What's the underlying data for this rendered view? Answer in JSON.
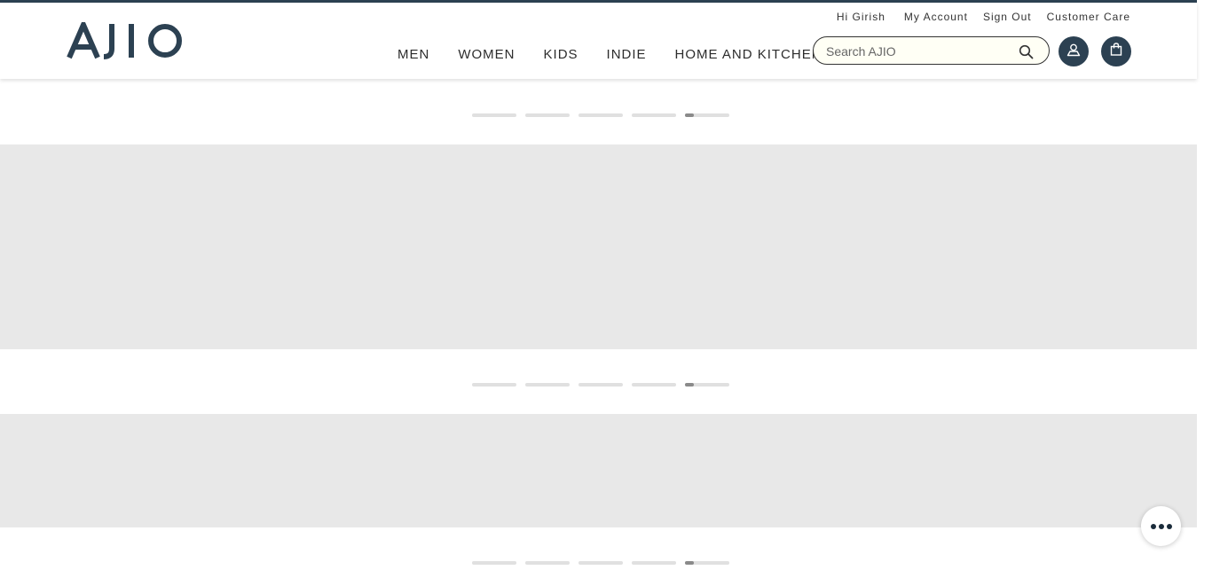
{
  "brand": {
    "logo_text": "AJIO",
    "color": "#2c4152"
  },
  "top_links": {
    "greeting": "Hi Girish",
    "my_account": "My Account",
    "sign_out": "Sign Out",
    "customer_care": "Customer Care"
  },
  "nav": {
    "men": "MEN",
    "women": "WOMEN",
    "kids": "KIDS",
    "indie": "INDIE",
    "home_kitchen": "HOME AND KITCHEN"
  },
  "search": {
    "placeholder": "Search AJIO",
    "value": ""
  },
  "icons": {
    "search": "search-icon",
    "account": "user-icon",
    "bag": "shopping-bag-icon",
    "chat": "more-dots-icon"
  },
  "carousels": [
    {
      "slides": 5,
      "active_index": 4
    },
    {
      "slides": 5,
      "active_index": 4
    },
    {
      "slides": 5,
      "active_index": 4
    }
  ],
  "colors": {
    "placeholder_banner": "#e8e8e8",
    "accent": "#2c4152"
  }
}
